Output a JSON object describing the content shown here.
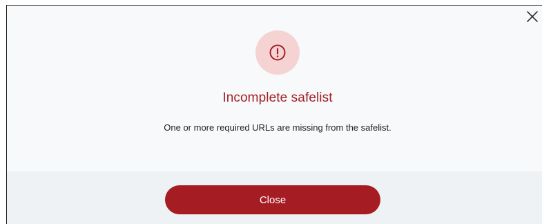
{
  "dialog": {
    "close_icon": "close-icon",
    "alert_icon": "exclamation-circle-icon",
    "title": "Incomplete safelist",
    "message": "One or more required URLs are missing from the safelist.",
    "close_button_label": "Close"
  },
  "colors": {
    "accent": "#a51d23",
    "alert_circle_bg": "#f6d3d3",
    "body_bg": "#f7f9fa",
    "footer_bg": "#eef2f5"
  }
}
